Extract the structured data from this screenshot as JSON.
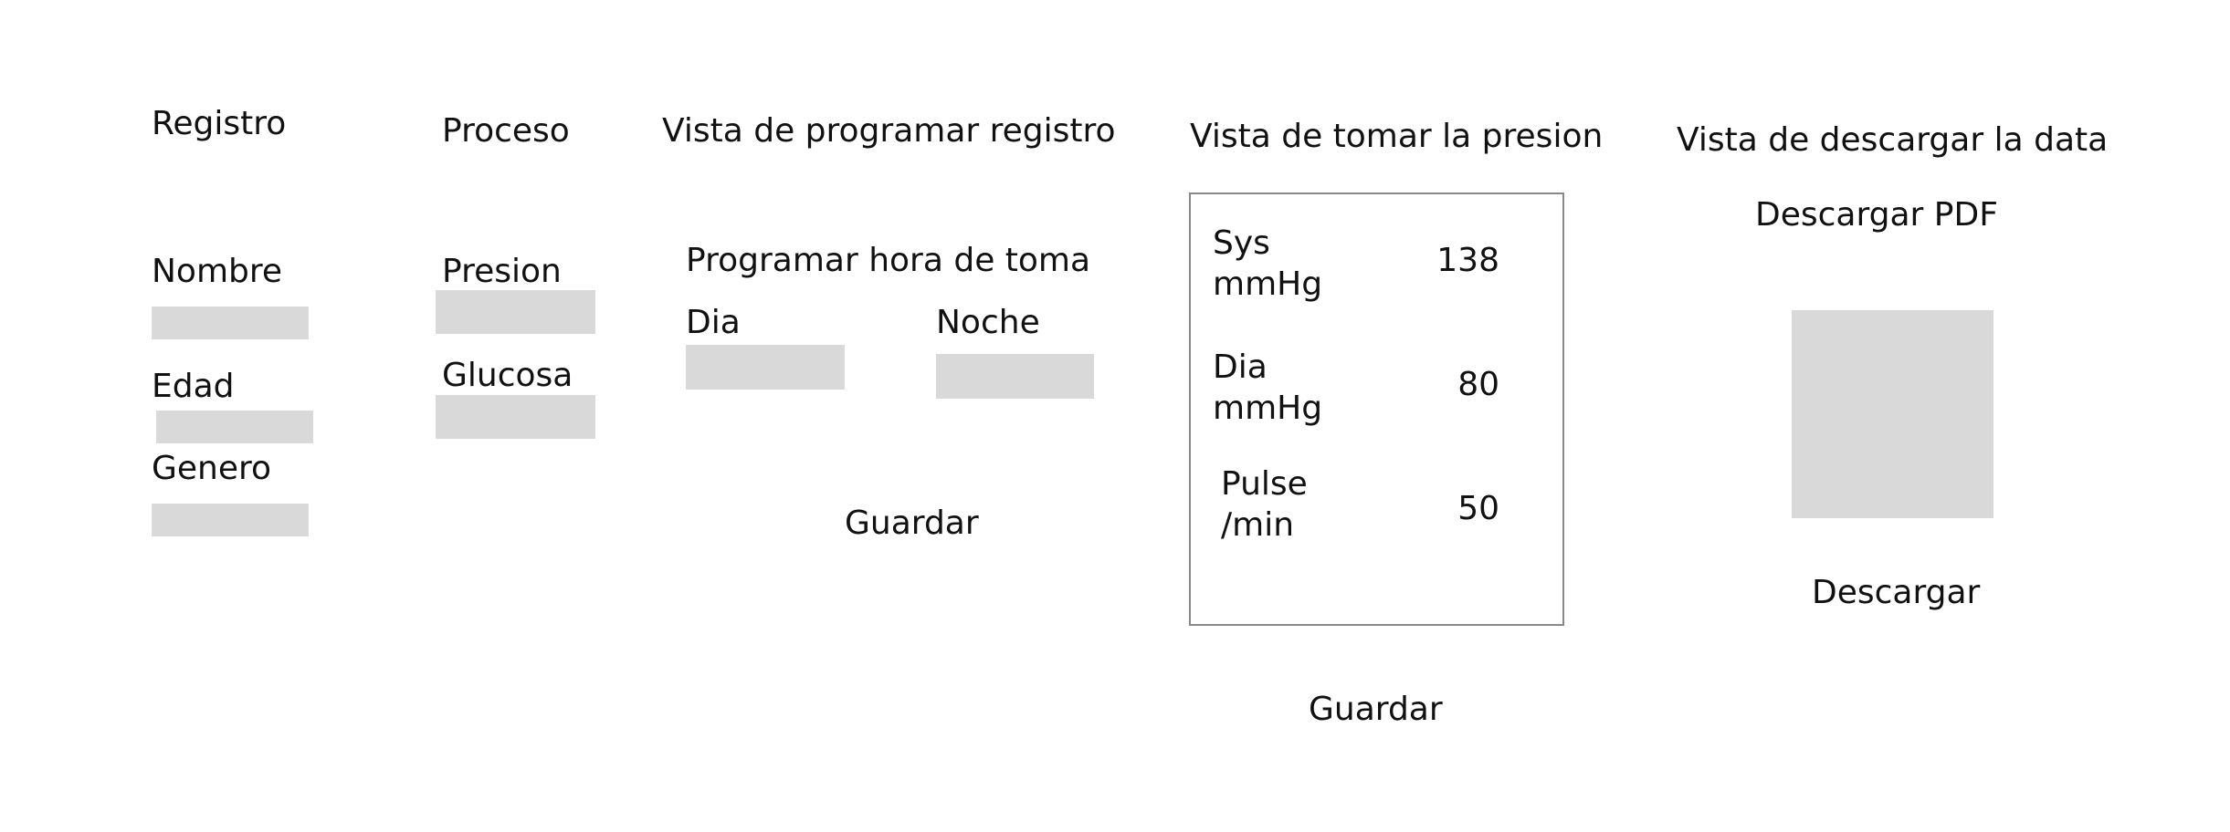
{
  "registro": {
    "title": "Registro",
    "nombre_label": "Nombre",
    "edad_label": "Edad",
    "genero_label": "Genero"
  },
  "proceso": {
    "title": "Proceso",
    "presion_label": "Presion",
    "glucosa_label": "Glucosa"
  },
  "programar": {
    "title": "Vista de programar registro",
    "subtitle": "Programar hora de toma",
    "dia_label": "Dia",
    "noche_label": "Noche",
    "save_label": "Guardar"
  },
  "presion": {
    "title": "Vista de tomar la presion",
    "readings": [
      {
        "label": "Sys\nmmHg",
        "value": "138"
      },
      {
        "label": "Dia\nmmHg",
        "value": "80"
      },
      {
        "label": "Pulse\n/min",
        "value": "50"
      }
    ],
    "save_label": "Guardar"
  },
  "descargar": {
    "title": "Vista de descargar la data",
    "pdf_label": "Descargar PDF",
    "download_label": "Descargar"
  },
  "colors": {
    "field_fill": "#d9d9d9",
    "box_border": "#888888",
    "text": "#111111"
  }
}
